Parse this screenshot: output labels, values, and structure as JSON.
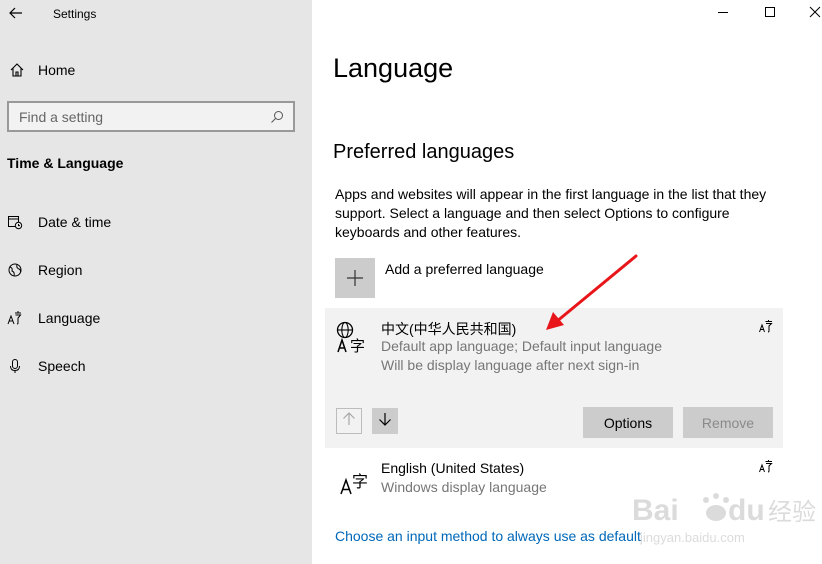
{
  "window": {
    "title": "Settings"
  },
  "sidebar": {
    "home_label": "Home",
    "search_placeholder": "Find a setting",
    "section_title": "Time & Language",
    "items": [
      {
        "label": "Date & time",
        "icon": "calendar-clock-icon"
      },
      {
        "label": "Region",
        "icon": "globe-icon"
      },
      {
        "label": "Language",
        "icon": "language-icon"
      },
      {
        "label": "Speech",
        "icon": "microphone-icon"
      }
    ]
  },
  "main": {
    "page_title": "Language",
    "section_title": "Preferred languages",
    "description": "Apps and websites will appear in the first language in the list that they support. Select a language and then select Options to configure keyboards and other features.",
    "add_language_label": "Add a preferred language",
    "languages": [
      {
        "name": "中文(中华人民共和国)",
        "detail1": "Default app language; Default input language",
        "detail2": "Will be display language after next sign-in",
        "options_label": "Options",
        "remove_label": "Remove"
      },
      {
        "name": "English (United States)",
        "detail1": "Windows display language"
      }
    ],
    "link": "Choose an input method to always use as default"
  },
  "colors": {
    "sidebar_bg": "#e6e6e6",
    "selected_card_bg": "#f2f2f2",
    "link": "#0067b8",
    "annotation_arrow": "#e8161b"
  }
}
